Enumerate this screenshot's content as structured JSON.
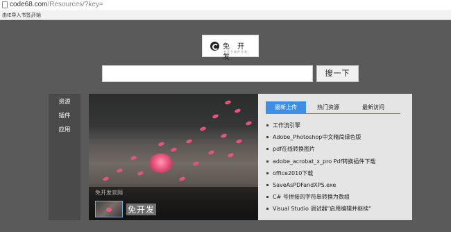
{
  "browser": {
    "url_domain": "code68.com",
    "url_path": "/Resources/?key=",
    "bookmarks": [
      "由IE导入书签。",
      "开始"
    ]
  },
  "logo": {
    "name": "免 开 发",
    "tagline": "专注于软件开发"
  },
  "search": {
    "value": "",
    "button_label": "搜一下"
  },
  "sidebar": {
    "items": [
      "资源",
      "插件",
      "应用"
    ]
  },
  "hero": {
    "caption": "免开发官网",
    "title": "免开发"
  },
  "panel": {
    "tabs": [
      "最新上传",
      "热门资源",
      "最新访问"
    ],
    "active_tab": "最新上传",
    "items": [
      "工作流引擎",
      "Adobe_Photoshop中文精简绿色版",
      "pdf在线转换图片",
      "adobe_acrobat_x_pro Pdf转换插件下载",
      "office2010下载",
      "SaveAsPDFandXPS.exe",
      "C# 号拼接的字符串转换为数组",
      "Visual Studio 调试器\"启用编辑并继续\""
    ]
  },
  "colors": {
    "accent": "#3d8ee4",
    "page_bg": "#5a5a5a",
    "sidebar_bg": "#4a4a4a",
    "panel_bg": "#e5e5e5"
  }
}
